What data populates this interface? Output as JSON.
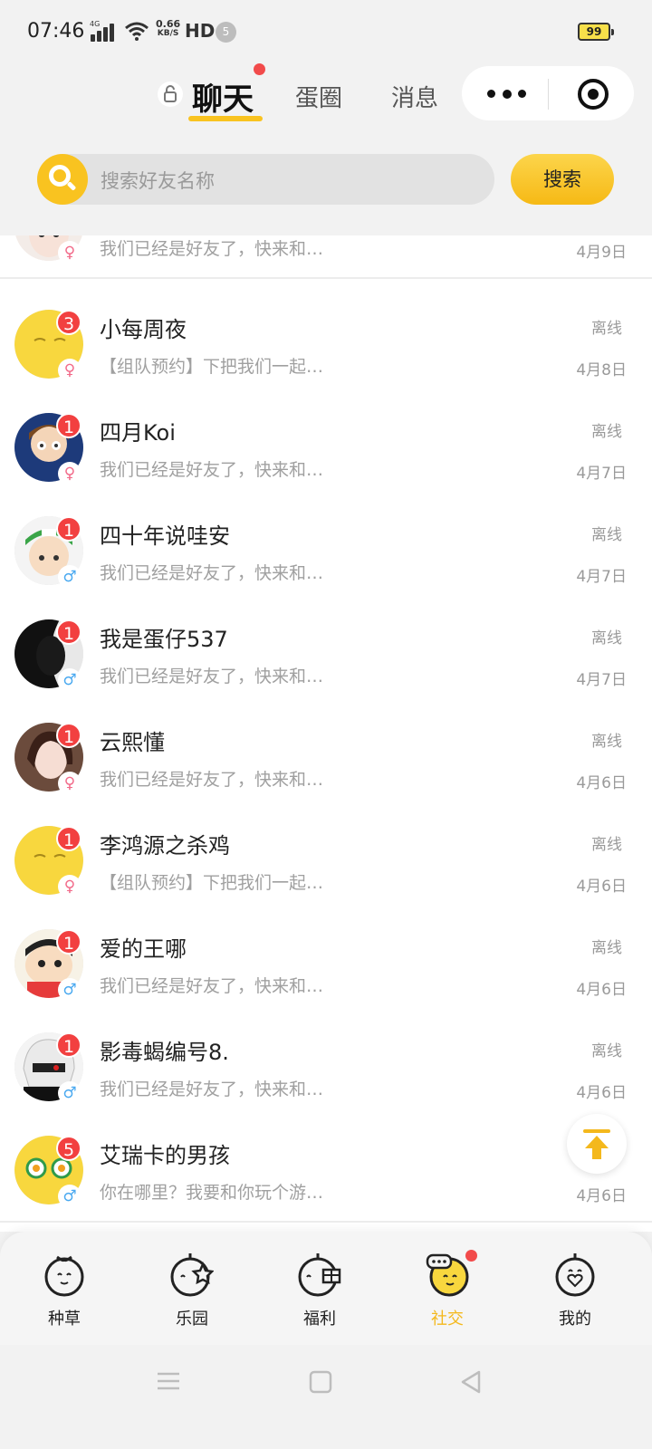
{
  "status_bar": {
    "time": "07:46",
    "network": "4G",
    "speed_value": "0.66",
    "speed_unit": "KB/S",
    "hd": "HD",
    "sim_count": "5",
    "battery": "99"
  },
  "header": {
    "tabs": [
      {
        "label": "聊天",
        "active": true
      },
      {
        "label": "蛋圈"
      },
      {
        "label": "消息"
      }
    ],
    "more_icon": "more-dots-icon",
    "target_icon": "target-icon"
  },
  "search": {
    "placeholder": "搜索好友名称",
    "button": "搜索"
  },
  "chats": [
    {
      "name": "",
      "message": "我们已经是好友了，快来和…",
      "status": "",
      "date": "4月9日",
      "badge": "",
      "gender": "♀"
    },
    {
      "name": "小每周夜",
      "message": "【组队预约】下把我们一起…",
      "status": "离线",
      "date": "4月8日",
      "badge": "3",
      "gender": "♀"
    },
    {
      "name": "四月Koi",
      "message": "我们已经是好友了，快来和…",
      "status": "离线",
      "date": "4月7日",
      "badge": "1",
      "gender": "♀"
    },
    {
      "name": "四十年说哇安",
      "message": "我们已经是好友了，快来和…",
      "status": "离线",
      "date": "4月7日",
      "badge": "1",
      "gender": "♂"
    },
    {
      "name": "我是蛋仔537",
      "message": "我们已经是好友了，快来和…",
      "status": "离线",
      "date": "4月7日",
      "badge": "1",
      "gender": "♂"
    },
    {
      "name": "云熙懂",
      "message": "我们已经是好友了，快来和…",
      "status": "离线",
      "date": "4月6日",
      "badge": "1",
      "gender": "♀"
    },
    {
      "name": "李鸿源之杀鸡",
      "message": "【组队预约】下把我们一起…",
      "status": "离线",
      "date": "4月6日",
      "badge": "1",
      "gender": "♀"
    },
    {
      "name": "爱的王哪",
      "message": "我们已经是好友了，快来和…",
      "status": "离线",
      "date": "4月6日",
      "badge": "1",
      "gender": "♂"
    },
    {
      "name": "影毒蝎编号8.",
      "message": "我们已经是好友了，快来和…",
      "status": "离线",
      "date": "4月6日",
      "badge": "1",
      "gender": "♂"
    },
    {
      "name": "艾瑞卡的男孩",
      "message": "你在哪里？我要和你玩个游…",
      "status": "",
      "date": "4月6日",
      "badge": "5",
      "gender": "♂"
    }
  ],
  "bottom_nav": [
    {
      "label": "种草",
      "icon": "grass-face-icon"
    },
    {
      "label": "乐园",
      "icon": "park-star-icon"
    },
    {
      "label": "福利",
      "icon": "gift-face-icon"
    },
    {
      "label": "社交",
      "icon": "chat-face-icon",
      "active": true
    },
    {
      "label": "我的",
      "icon": "heart-face-icon"
    }
  ],
  "colors": {
    "accent": "#f9c320",
    "badge": "#f24040",
    "female": "#f26b8a",
    "male": "#4aa9f0"
  }
}
